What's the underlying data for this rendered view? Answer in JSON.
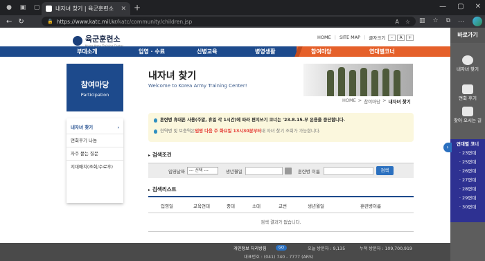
{
  "browser": {
    "tab_title": "내자녀 찾기 | 육군훈련소",
    "url_main": "https://www.katc.mil.kr",
    "url_path": "/katc/community/children.jsp"
  },
  "header": {
    "logo_text": "육군훈련소",
    "logo_sub": "Korea Army Training Center",
    "links": [
      "HOME",
      "SITE MAP"
    ],
    "font_size_label": "글자크기",
    "font_minus": "-",
    "font_mid": "A",
    "font_plus": "+"
  },
  "gnb": {
    "items": [
      "부대소개",
      "입영 · 수료",
      "신병교육",
      "병영생활",
      "참여마당",
      "연대별코너"
    ]
  },
  "sidebar": {
    "title": "참여마당",
    "subtitle": "Participation",
    "items": [
      {
        "label": "내자녀 찾기",
        "arrow": "›"
      },
      {
        "label": "면회후기 나눔"
      },
      {
        "label": "자주 묻는 질문"
      },
      {
        "label": "지대배치(조회/수료후)"
      }
    ]
  },
  "content": {
    "title": "내자녀 찾기",
    "subtitle": "Welcome to Korea Army Training Center!",
    "breadcrumb": [
      "HOME",
      ">",
      "참여마당",
      ">",
      "내자녀 찾기"
    ],
    "notice1": "훈련병 휴대폰 사용(주말, 휴일 각 1시간)에 따라 편지쓰기 코너는 '23.8.15.부 운용을 중단합니다.",
    "notice2_pre": "현역병 및 보충역은 ",
    "notice2_red": "입영 다음 주 화요일 13시30분부터",
    "notice2_post": " 내 자녀 찾기 조회가 가능합니다.",
    "search_heading": "검색조건",
    "search": {
      "date_label": "입영날짜",
      "date_select": "--- 선택 ---",
      "birth_label": "생년월일",
      "name_label": "훈련병 이름",
      "button": "검색"
    },
    "list_heading": "검색리스트",
    "columns": [
      "입영일",
      "교육연대",
      "중대",
      "소대",
      "교번",
      "생년월일",
      "훈련병이름"
    ],
    "empty_message": "검색 결과가 없습니다."
  },
  "footer": {
    "privacy": "개인정보 처리방침",
    "go": "GO",
    "today_visitors": "오늘 방문자 : 9,135",
    "total_visitors": "누적 방문자 : 109,700,919",
    "phone": "대표번호 : (041) 740 - 7777 (ARS)"
  },
  "right_panel": {
    "title": "바로가기",
    "links": [
      "내자녀 찾기",
      "면회 후기",
      "찾아 오시는 길"
    ],
    "regiment_title": "연대별 코너",
    "regiments": [
      "· 23연대",
      "· 25연대",
      "· 26연대",
      "· 27연대",
      "· 28연대",
      "· 29연대",
      "· 30연대"
    ],
    "toggle": "›"
  }
}
